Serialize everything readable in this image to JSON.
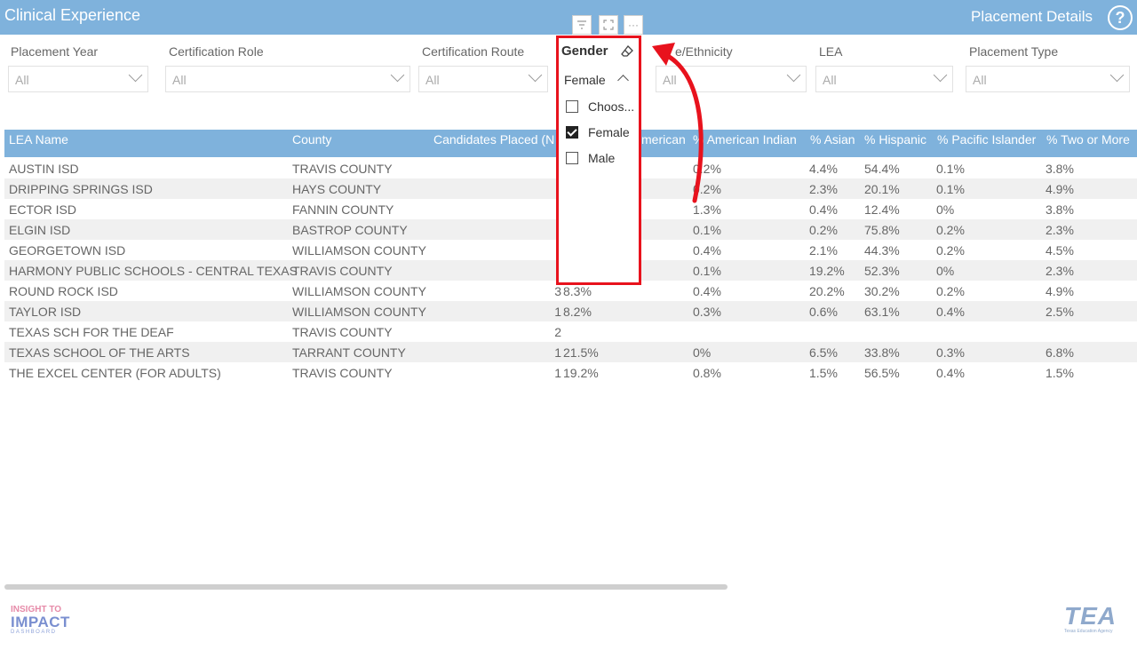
{
  "header": {
    "title": "Clinical Experience",
    "page_title": "Placement Details"
  },
  "filters": [
    {
      "label": "Placement Year",
      "value": "All"
    },
    {
      "label": "Certification Role",
      "value": "All"
    },
    {
      "label": "Certification Route",
      "value": "All"
    },
    {
      "label": "e/Ethnicity",
      "value": "All"
    },
    {
      "label": "LEA",
      "value": "All"
    },
    {
      "label": "Placement Type",
      "value": "All"
    }
  ],
  "gender_slicer": {
    "label": "Gender",
    "value": "Female",
    "options": [
      {
        "label": "Choos...",
        "checked": false
      },
      {
        "label": "Female",
        "checked": true
      },
      {
        "label": "Male",
        "checked": false
      }
    ]
  },
  "table": {
    "columns": [
      "LEA Name",
      "County",
      "Candidates Placed (N",
      "merican",
      "% American Indian",
      "% Asian",
      "% Hispanic",
      "% Pacific Islander",
      "% Two or More"
    ],
    "rows": [
      [
        "AUSTIN ISD",
        "TRAVIS COUNTY",
        "",
        "",
        "0.2%",
        "4.4%",
        "54.4%",
        "0.1%",
        "3.8%"
      ],
      [
        "DRIPPING SPRINGS ISD",
        "HAYS COUNTY",
        "",
        "",
        "0.2%",
        "2.3%",
        "20.1%",
        "0.1%",
        "4.9%"
      ],
      [
        "ECTOR ISD",
        "FANNIN COUNTY",
        "",
        "",
        "1.3%",
        "0.4%",
        "12.4%",
        "0%",
        "3.8%"
      ],
      [
        "ELGIN ISD",
        "BASTROP COUNTY",
        "",
        "",
        "0.1%",
        "0.2%",
        "75.8%",
        "0.2%",
        "2.3%"
      ],
      [
        "GEORGETOWN ISD",
        "WILLIAMSON COUNTY",
        "",
        "",
        "0.4%",
        "2.1%",
        "44.3%",
        "0.2%",
        "4.5%"
      ],
      [
        "HARMONY PUBLIC SCHOOLS - CENTRAL TEXAS",
        "TRAVIS COUNTY",
        "",
        "",
        "0.1%",
        "19.2%",
        "52.3%",
        "0%",
        "2.3%"
      ],
      [
        "ROUND ROCK ISD",
        "WILLIAMSON COUNTY",
        "3",
        "8.3%",
        "0.4%",
        "20.2%",
        "30.2%",
        "0.2%",
        "4.9%"
      ],
      [
        "TAYLOR ISD",
        "WILLIAMSON COUNTY",
        "1",
        "8.2%",
        "0.3%",
        "0.6%",
        "63.1%",
        "0.4%",
        "2.5%"
      ],
      [
        "TEXAS SCH FOR THE DEAF",
        "TRAVIS COUNTY",
        "2",
        "",
        "",
        "",
        "",
        "",
        ""
      ],
      [
        "TEXAS SCHOOL OF THE ARTS",
        "TARRANT COUNTY",
        "1",
        "21.5%",
        "0%",
        "6.5%",
        "33.8%",
        "0.3%",
        "6.8%"
      ],
      [
        "THE EXCEL CENTER (FOR ADULTS)",
        "TRAVIS COUNTY",
        "1",
        "19.2%",
        "0.8%",
        "1.5%",
        "56.5%",
        "0.4%",
        "1.5%"
      ]
    ]
  },
  "logos": {
    "left_line1": "INSIGHT TO",
    "left_line2": "IMPACT",
    "left_line3": "DASHBOARD",
    "right_main": "TEA",
    "right_sub": "Texas Education Agency"
  },
  "colors": {
    "header": "#7fb2dc",
    "highlight": "#e8121d"
  }
}
